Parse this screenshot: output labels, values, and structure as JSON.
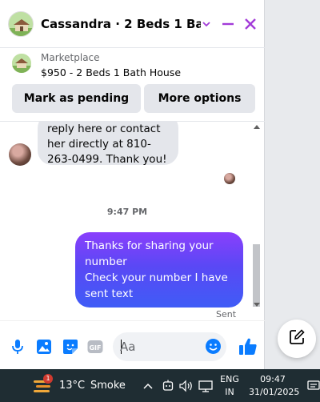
{
  "header": {
    "title": "Cassandra · 2 Beds 1 Bath ...",
    "chevron_icon": "chevron-down-icon",
    "minimize_icon": "minimize-icon",
    "close_icon": "close-icon"
  },
  "marketplace": {
    "label": "Marketplace",
    "listing_title": "$950 - 2 Beds 1 Bath House",
    "mark_pending_label": "Mark as pending",
    "more_options_label": "More options"
  },
  "messages": {
    "incoming": [
      "reply here or contact",
      "her directly at 810-",
      "263-0499. Thank you!"
    ],
    "timestamp": "9:47 PM",
    "outgoing": [
      "Thanks for sharing your",
      "number",
      "Check your number I have",
      "sent text"
    ],
    "status": "Sent"
  },
  "composer": {
    "placeholder": "Aa",
    "icons": [
      "microphone-icon",
      "photo-icon",
      "sticker-icon",
      "gif-icon",
      "emoji-icon",
      "thumbs-up-icon"
    ],
    "gif_label": "GIF"
  },
  "compose_fab_icon": "new-message-icon",
  "taskbar": {
    "notification_count": "1",
    "temperature": "13°C",
    "condition": "Smoke",
    "lang_line1": "ENG",
    "lang_line2": "IN",
    "time": "09:47",
    "date": "31/01/2025"
  },
  "colors": {
    "accent": "#a23bd8",
    "outgoing_top": "#8a3ffc",
    "outgoing_bottom": "#3f5cf6",
    "icon_blue": "#0a7cff",
    "taskbar": "#1f2d33"
  }
}
